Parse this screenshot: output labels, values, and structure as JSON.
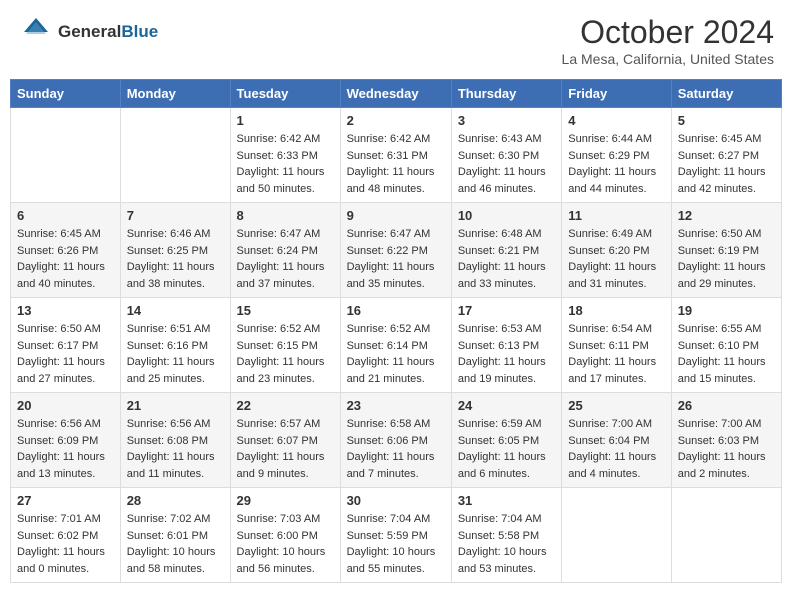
{
  "header": {
    "logo_general": "General",
    "logo_blue": "Blue",
    "month_title": "October 2024",
    "location": "La Mesa, California, United States"
  },
  "weekdays": [
    "Sunday",
    "Monday",
    "Tuesday",
    "Wednesday",
    "Thursday",
    "Friday",
    "Saturday"
  ],
  "weeks": [
    [
      {
        "day": "",
        "sunrise": "",
        "sunset": "",
        "daylight": ""
      },
      {
        "day": "",
        "sunrise": "",
        "sunset": "",
        "daylight": ""
      },
      {
        "day": "1",
        "sunrise": "Sunrise: 6:42 AM",
        "sunset": "Sunset: 6:33 PM",
        "daylight": "Daylight: 11 hours and 50 minutes."
      },
      {
        "day": "2",
        "sunrise": "Sunrise: 6:42 AM",
        "sunset": "Sunset: 6:31 PM",
        "daylight": "Daylight: 11 hours and 48 minutes."
      },
      {
        "day": "3",
        "sunrise": "Sunrise: 6:43 AM",
        "sunset": "Sunset: 6:30 PM",
        "daylight": "Daylight: 11 hours and 46 minutes."
      },
      {
        "day": "4",
        "sunrise": "Sunrise: 6:44 AM",
        "sunset": "Sunset: 6:29 PM",
        "daylight": "Daylight: 11 hours and 44 minutes."
      },
      {
        "day": "5",
        "sunrise": "Sunrise: 6:45 AM",
        "sunset": "Sunset: 6:27 PM",
        "daylight": "Daylight: 11 hours and 42 minutes."
      }
    ],
    [
      {
        "day": "6",
        "sunrise": "Sunrise: 6:45 AM",
        "sunset": "Sunset: 6:26 PM",
        "daylight": "Daylight: 11 hours and 40 minutes."
      },
      {
        "day": "7",
        "sunrise": "Sunrise: 6:46 AM",
        "sunset": "Sunset: 6:25 PM",
        "daylight": "Daylight: 11 hours and 38 minutes."
      },
      {
        "day": "8",
        "sunrise": "Sunrise: 6:47 AM",
        "sunset": "Sunset: 6:24 PM",
        "daylight": "Daylight: 11 hours and 37 minutes."
      },
      {
        "day": "9",
        "sunrise": "Sunrise: 6:47 AM",
        "sunset": "Sunset: 6:22 PM",
        "daylight": "Daylight: 11 hours and 35 minutes."
      },
      {
        "day": "10",
        "sunrise": "Sunrise: 6:48 AM",
        "sunset": "Sunset: 6:21 PM",
        "daylight": "Daylight: 11 hours and 33 minutes."
      },
      {
        "day": "11",
        "sunrise": "Sunrise: 6:49 AM",
        "sunset": "Sunset: 6:20 PM",
        "daylight": "Daylight: 11 hours and 31 minutes."
      },
      {
        "day": "12",
        "sunrise": "Sunrise: 6:50 AM",
        "sunset": "Sunset: 6:19 PM",
        "daylight": "Daylight: 11 hours and 29 minutes."
      }
    ],
    [
      {
        "day": "13",
        "sunrise": "Sunrise: 6:50 AM",
        "sunset": "Sunset: 6:17 PM",
        "daylight": "Daylight: 11 hours and 27 minutes."
      },
      {
        "day": "14",
        "sunrise": "Sunrise: 6:51 AM",
        "sunset": "Sunset: 6:16 PM",
        "daylight": "Daylight: 11 hours and 25 minutes."
      },
      {
        "day": "15",
        "sunrise": "Sunrise: 6:52 AM",
        "sunset": "Sunset: 6:15 PM",
        "daylight": "Daylight: 11 hours and 23 minutes."
      },
      {
        "day": "16",
        "sunrise": "Sunrise: 6:52 AM",
        "sunset": "Sunset: 6:14 PM",
        "daylight": "Daylight: 11 hours and 21 minutes."
      },
      {
        "day": "17",
        "sunrise": "Sunrise: 6:53 AM",
        "sunset": "Sunset: 6:13 PM",
        "daylight": "Daylight: 11 hours and 19 minutes."
      },
      {
        "day": "18",
        "sunrise": "Sunrise: 6:54 AM",
        "sunset": "Sunset: 6:11 PM",
        "daylight": "Daylight: 11 hours and 17 minutes."
      },
      {
        "day": "19",
        "sunrise": "Sunrise: 6:55 AM",
        "sunset": "Sunset: 6:10 PM",
        "daylight": "Daylight: 11 hours and 15 minutes."
      }
    ],
    [
      {
        "day": "20",
        "sunrise": "Sunrise: 6:56 AM",
        "sunset": "Sunset: 6:09 PM",
        "daylight": "Daylight: 11 hours and 13 minutes."
      },
      {
        "day": "21",
        "sunrise": "Sunrise: 6:56 AM",
        "sunset": "Sunset: 6:08 PM",
        "daylight": "Daylight: 11 hours and 11 minutes."
      },
      {
        "day": "22",
        "sunrise": "Sunrise: 6:57 AM",
        "sunset": "Sunset: 6:07 PM",
        "daylight": "Daylight: 11 hours and 9 minutes."
      },
      {
        "day": "23",
        "sunrise": "Sunrise: 6:58 AM",
        "sunset": "Sunset: 6:06 PM",
        "daylight": "Daylight: 11 hours and 7 minutes."
      },
      {
        "day": "24",
        "sunrise": "Sunrise: 6:59 AM",
        "sunset": "Sunset: 6:05 PM",
        "daylight": "Daylight: 11 hours and 6 minutes."
      },
      {
        "day": "25",
        "sunrise": "Sunrise: 7:00 AM",
        "sunset": "Sunset: 6:04 PM",
        "daylight": "Daylight: 11 hours and 4 minutes."
      },
      {
        "day": "26",
        "sunrise": "Sunrise: 7:00 AM",
        "sunset": "Sunset: 6:03 PM",
        "daylight": "Daylight: 11 hours and 2 minutes."
      }
    ],
    [
      {
        "day": "27",
        "sunrise": "Sunrise: 7:01 AM",
        "sunset": "Sunset: 6:02 PM",
        "daylight": "Daylight: 11 hours and 0 minutes."
      },
      {
        "day": "28",
        "sunrise": "Sunrise: 7:02 AM",
        "sunset": "Sunset: 6:01 PM",
        "daylight": "Daylight: 10 hours and 58 minutes."
      },
      {
        "day": "29",
        "sunrise": "Sunrise: 7:03 AM",
        "sunset": "Sunset: 6:00 PM",
        "daylight": "Daylight: 10 hours and 56 minutes."
      },
      {
        "day": "30",
        "sunrise": "Sunrise: 7:04 AM",
        "sunset": "Sunset: 5:59 PM",
        "daylight": "Daylight: 10 hours and 55 minutes."
      },
      {
        "day": "31",
        "sunrise": "Sunrise: 7:04 AM",
        "sunset": "Sunset: 5:58 PM",
        "daylight": "Daylight: 10 hours and 53 minutes."
      },
      {
        "day": "",
        "sunrise": "",
        "sunset": "",
        "daylight": ""
      },
      {
        "day": "",
        "sunrise": "",
        "sunset": "",
        "daylight": ""
      }
    ]
  ]
}
